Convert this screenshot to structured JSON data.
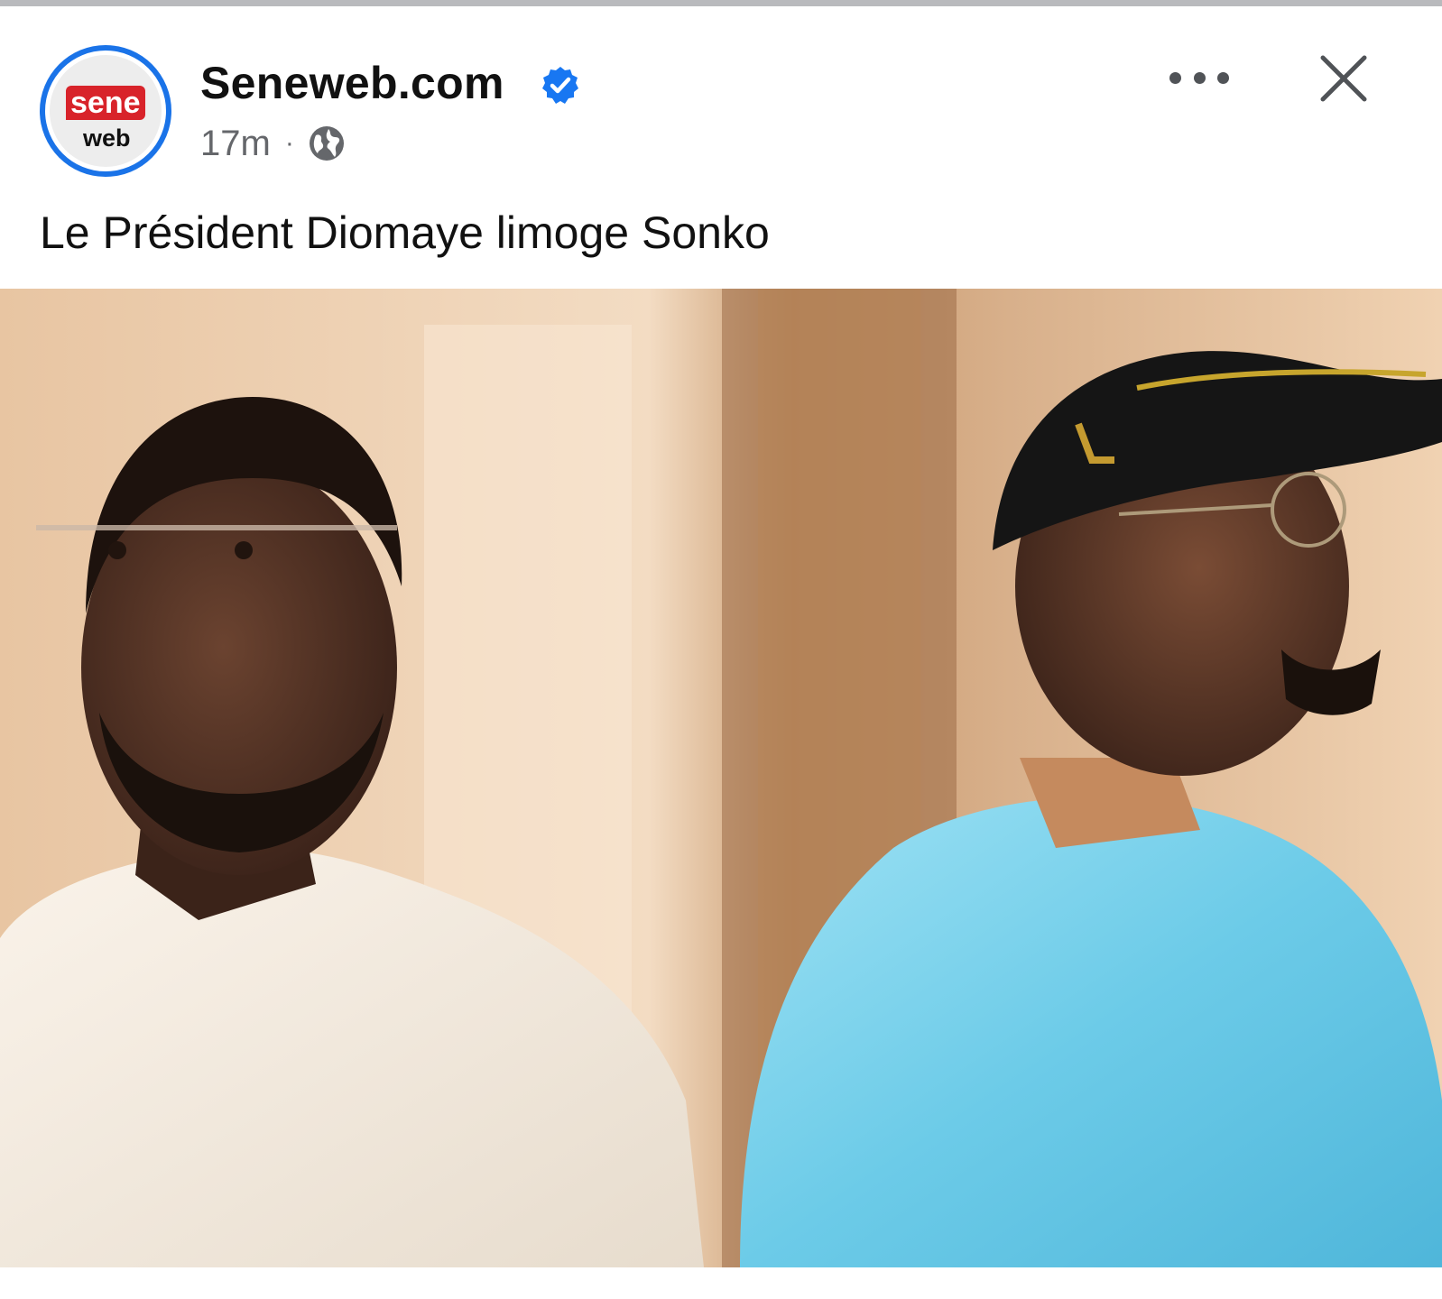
{
  "post": {
    "page_name": "Seneweb.com",
    "timestamp": "17m",
    "separator": "·",
    "audience_icon": "globe-icon",
    "verified_icon": "verified-badge-icon",
    "caption": "Le Président Diomaye limoge Sonko"
  },
  "avatar": {
    "logo_top": "sene",
    "logo_bottom": "web"
  },
  "actions": {
    "more_icon": "more-options-icon",
    "close_icon": "close-icon"
  },
  "colors": {
    "verified_blue": "#1877f2",
    "avatar_ring": "#1a73e8",
    "logo_red": "#d8232a",
    "meta_gray": "#65676b"
  }
}
